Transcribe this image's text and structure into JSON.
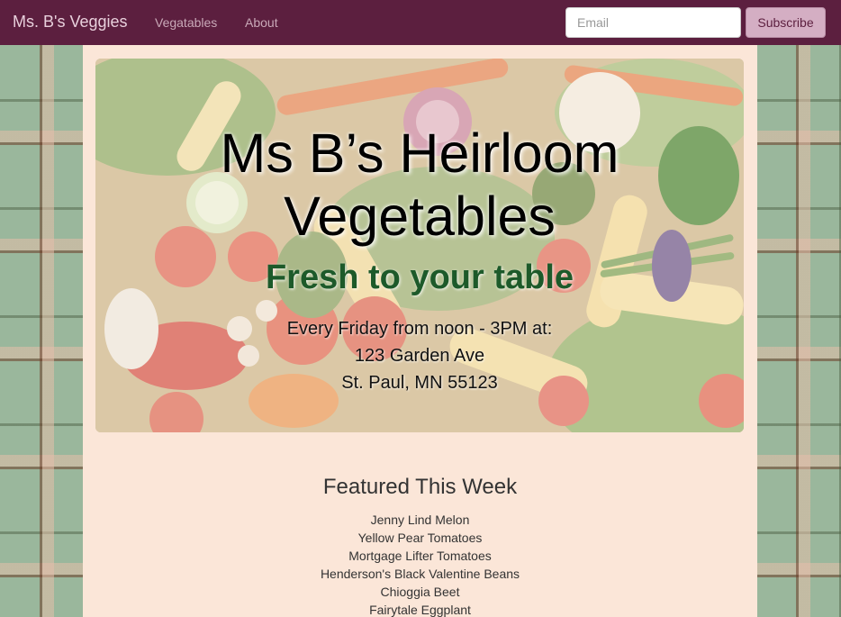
{
  "navbar": {
    "brand": "Ms. B's Veggies",
    "links": [
      "Vegatables",
      "About"
    ],
    "email_placeholder": "Email",
    "subscribe_label": "Subscribe",
    "bg_color": "#5c1f3f"
  },
  "hero": {
    "title_line1": "Ms B’s Heirloom",
    "title_line2": "Vegetables",
    "subtitle": "Fresh to your table",
    "schedule": "Every Friday from noon - 3PM at:",
    "address_line1": "123 Garden Ave",
    "address_line2": "St. Paul, MN 55123",
    "subtitle_color": "#1d5a2a"
  },
  "featured": {
    "title": "Featured This Week",
    "items": [
      "Jenny Lind Melon",
      "Yellow Pear Tomatoes",
      "Mortgage Lifter Tomatoes",
      "Henderson's Black Valentine Beans",
      "Chioggia Beet",
      "Fairytale Eggplant"
    ]
  },
  "icons": {
    "hero_image": "vegetables-photo"
  }
}
